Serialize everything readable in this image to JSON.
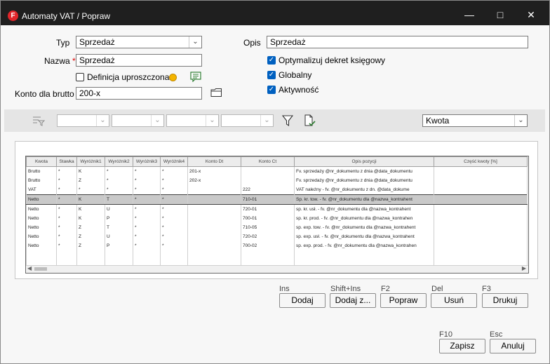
{
  "window": {
    "title": "Automaty VAT / Popraw",
    "app_icon_letter": "F",
    "controls": [
      "minimize-icon",
      "maximize-icon",
      "close-icon"
    ]
  },
  "form": {
    "typ_label": "Typ",
    "typ_value": "Sprzedaż",
    "nazwa_label": "Nazwa",
    "nazwa_required": "*",
    "nazwa_value": "Sprzedaż",
    "definicja_label": "Definicja uproszczona",
    "definicja_checked": false,
    "konto_label": "Konto dla brutto",
    "konto_value": "200-x",
    "opis_label": "Opis",
    "opis_value": "Sprzedaż",
    "optymalizuj_label": "Optymalizuj dekret księgowy",
    "optymalizuj_checked": true,
    "globalny_label": "Globalny",
    "globalny_checked": true,
    "aktywnosc_label": "Aktywność",
    "aktywnosc_checked": true
  },
  "toolbar": {
    "kwota_value": "Kwota",
    "icons": [
      "filter-settings-icon",
      "funnel-icon",
      "export-document-icon"
    ]
  },
  "table": {
    "headers": [
      "Kwota",
      "Stawka",
      "Wyróżnik1",
      "Wyróżnik2",
      "Wyróżnik3",
      "Wyróżnik4",
      "Konto Dt",
      "Konto Ct",
      "Opis pozycji",
      "Część kwoty [%]"
    ],
    "rows": [
      [
        "Brutto",
        "*",
        "K",
        "*",
        "*",
        "*",
        "201-x",
        "",
        "Fv. sprzedaży @nr_dokumentu z dnia @data_dokumentu",
        ""
      ],
      [
        "Brutto",
        "*",
        "Z",
        "*",
        "*",
        "*",
        "202-x",
        "",
        "Fv. sprzedaży @nr_dokumentu z dnia @data_dokumentu",
        ""
      ],
      [
        "VAT",
        "*",
        "*",
        "*",
        "*",
        "*",
        "",
        "222",
        "VAT należny - fv. @nr_dokumentu z dn. @data_dokume",
        ""
      ],
      [
        "Netto",
        "*",
        "K",
        "T",
        "*",
        "*",
        "",
        "710-01",
        "Sp. kr. tow. - fv. @nr_dokumentu dla @nazwa_kontrahent",
        ""
      ],
      [
        "Netto",
        "*",
        "K",
        "U",
        "*",
        "*",
        "",
        "720-01",
        "sp. kr. usł. - fv. @nr_dokumentu dla @nazwa_kontrahent",
        ""
      ],
      [
        "Netto",
        "*",
        "K",
        "P",
        "*",
        "*",
        "",
        "700-01",
        "sp. kr. prod. - fv. @nr_dokumentu dla @nazwa_kontrahen",
        ""
      ],
      [
        "Netto",
        "*",
        "Z",
        "T",
        "*",
        "*",
        "",
        "710-05",
        "sp. exp. tow. - fv. @nr_dokumentu dla @nazwa_kontrahent",
        ""
      ],
      [
        "Netto",
        "*",
        "Z",
        "U",
        "*",
        "*",
        "",
        "720-02",
        "sp. exp. usł. - fv. @nr_dokumentu dla @nazwa_kontrahent",
        ""
      ],
      [
        "Netto",
        "*",
        "Z",
        "P",
        "*",
        "*",
        "",
        "700-02",
        "sp. exp. prod. - fv. @nr_dokumentu dla @nazwa_kontrahen",
        ""
      ]
    ],
    "selected_row": 3
  },
  "actions": {
    "dodaj_hotkey": "Ins",
    "dodaj_label": "Dodaj",
    "dodajz_hotkey": "Shift+Ins",
    "dodajz_label": "Dodaj z...",
    "popraw_hotkey": "F2",
    "popraw_label": "Popraw",
    "usun_hotkey": "Del",
    "usun_label": "Usuń",
    "drukuj_hotkey": "F3",
    "drukuj_label": "Drukuj"
  },
  "footer": {
    "zapisz_hotkey": "F10",
    "zapisz_label": "Zapisz",
    "anuluj_hotkey": "Esc",
    "anuluj_label": "Anuluj"
  },
  "colors": {
    "titlebar": "#1f1f1f",
    "checkbox_accent": "#0060c0",
    "app_icon": "#e1252a"
  }
}
